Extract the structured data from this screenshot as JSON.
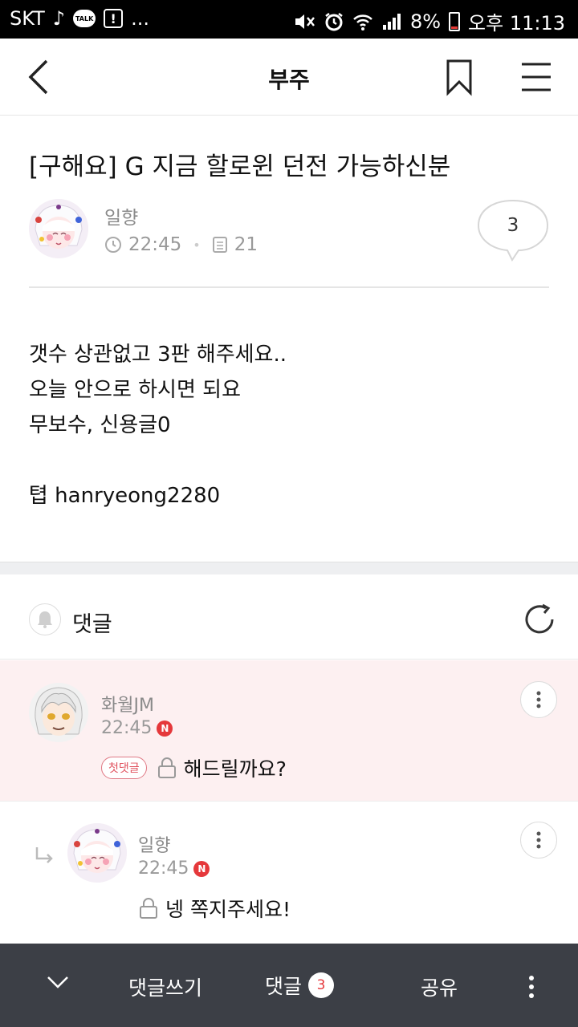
{
  "status_bar": {
    "carrier": "SKT",
    "talk_label": "TALK",
    "more": "...",
    "battery": "8%",
    "time": "오후 11:13"
  },
  "header": {
    "title": "부주"
  },
  "post": {
    "title": "[구해요] G 지금 할로윈 던전 가능하신분",
    "author": "일향",
    "time": "22:45",
    "views": "21",
    "comment_count": "3",
    "body": [
      "갯수 상관없고 3판 해주세요..",
      "오늘 안으로 하시면 되요",
      "무보수, 신용글0",
      "",
      "텹 hanryeong2280"
    ]
  },
  "comments_section": {
    "label": "댓글"
  },
  "comments": [
    {
      "author": "화월JM",
      "time": "22:45",
      "new_badge": "N",
      "first_badge": "첫댓글",
      "text": "해드릴까요?"
    },
    {
      "author": "일향",
      "time": "22:45",
      "new_badge": "N",
      "text": "넹 쪽지주세요!"
    }
  ],
  "bottom_bar": {
    "write_label": "댓글쓰기",
    "comments_label": "댓글",
    "comments_count": "3",
    "share_label": "공유"
  },
  "colors": {
    "accent_red": "#e5383b",
    "highlight_bg": "#fdf0f1",
    "bottom_bar_bg": "#3c3f46"
  }
}
